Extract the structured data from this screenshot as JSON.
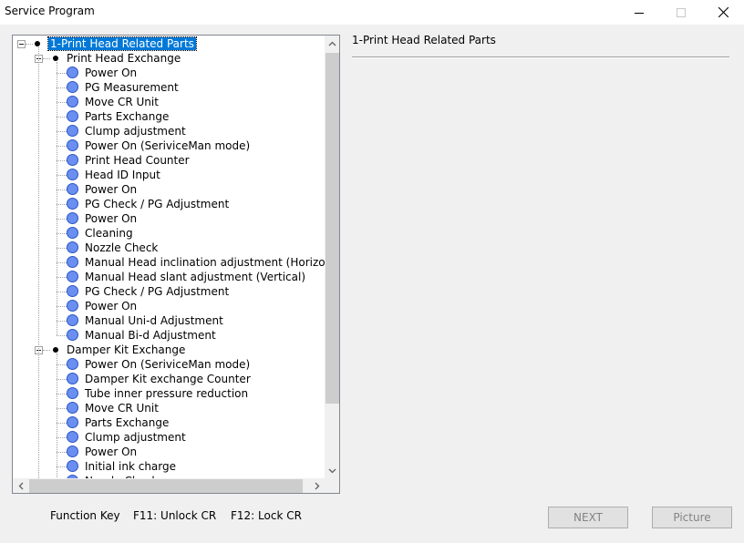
{
  "window": {
    "title": "Service Program"
  },
  "tree": {
    "root": {
      "label": "1-Print Head Related Parts",
      "expander": "minus"
    },
    "groups": [
      {
        "label": "Print Head Exchange",
        "items": [
          "Power On",
          "PG Measurement",
          "Move CR Unit",
          "Parts Exchange",
          "Clump adjustment",
          "Power On (SeriviceMan mode)",
          "Print Head Counter",
          "Head ID Input",
          "Power On",
          "PG Check / PG Adjustment",
          "Power On",
          "Cleaning",
          "Nozzle Check",
          "Manual Head inclination adjustment (Horizontal",
          "Manual Head slant adjustment (Vertical)",
          "PG Check / PG Adjustment",
          "Power On",
          "Manual Uni-d Adjustment",
          "Manual Bi-d Adjustment"
        ]
      },
      {
        "label": "Damper Kit Exchange",
        "items": [
          "Power On (SeriviceMan mode)",
          "Damper Kit exchange Counter",
          "Tube inner pressure reduction",
          "Move CR Unit",
          "Parts Exchange",
          "Clump adjustment",
          "Power On",
          "Initial ink charge",
          "Nozzle Check"
        ]
      }
    ],
    "leaf_icon_color": "#6a8ff0",
    "selection_color": "#0078d7"
  },
  "detail": {
    "title": "1-Print Head Related Parts"
  },
  "footer": {
    "function_key": "Function Key",
    "f11": "F11: Unlock CR",
    "f12": "F12: Lock CR",
    "next_label": "NEXT",
    "picture_label": "Picture"
  }
}
